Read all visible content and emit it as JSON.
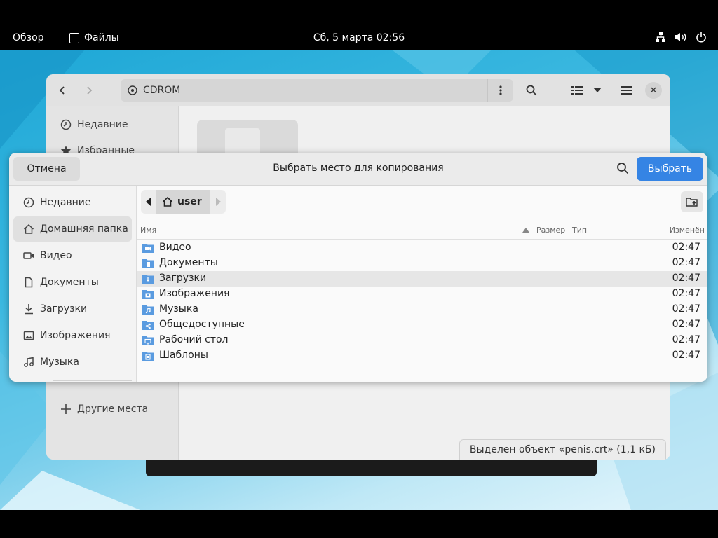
{
  "topbar": {
    "overview": "Обзор",
    "app_name": "Файлы",
    "clock": "Сб, 5 марта  02:56"
  },
  "files_window": {
    "path": "CDROM",
    "sidebar": [
      {
        "label": "Недавние",
        "icon": "clock-icon"
      },
      {
        "label": "Избранные",
        "icon": "star-icon"
      },
      {
        "label": "Другие места",
        "icon": "plus-icon"
      }
    ],
    "status": "Выделен объект «penis.crt» (1,1 кБ)"
  },
  "dialog": {
    "cancel_label": "Отмена",
    "title": "Выбрать место для копирования",
    "select_label": "Выбрать",
    "breadcrumb": "user",
    "sidebar": [
      {
        "label": "Недавние",
        "icon": "clock-icon"
      },
      {
        "label": "Домашняя папка",
        "icon": "home-icon"
      },
      {
        "label": "Видео",
        "icon": "video-icon"
      },
      {
        "label": "Документы",
        "icon": "document-icon"
      },
      {
        "label": "Загрузки",
        "icon": "download-icon"
      },
      {
        "label": "Изображения",
        "icon": "image-icon"
      },
      {
        "label": "Музыка",
        "icon": "music-icon"
      }
    ],
    "columns": {
      "name": "Имя",
      "size": "Размер",
      "type": "Тип",
      "modified": "Изменён"
    },
    "files": [
      {
        "name": "Видео",
        "modified": "02:47"
      },
      {
        "name": "Документы",
        "modified": "02:47"
      },
      {
        "name": "Загрузки",
        "modified": "02:47"
      },
      {
        "name": "Изображения",
        "modified": "02:47"
      },
      {
        "name": "Музыка",
        "modified": "02:47"
      },
      {
        "name": "Общедоступные",
        "modified": "02:47"
      },
      {
        "name": "Рабочий стол",
        "modified": "02:47"
      },
      {
        "name": "Шаблоны",
        "modified": "02:47"
      }
    ],
    "selected_row": 2
  },
  "colors": {
    "accent": "#3584e4",
    "folder": "#5a9be0"
  }
}
